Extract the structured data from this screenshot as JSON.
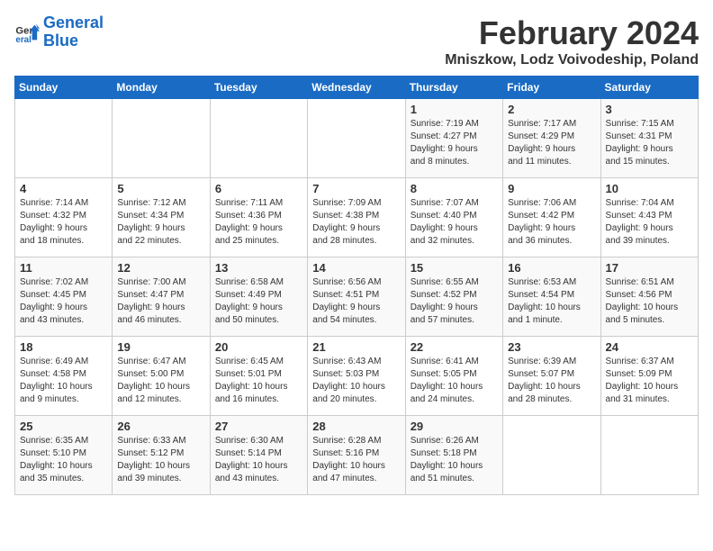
{
  "logo": {
    "line1": "General",
    "line2": "Blue"
  },
  "title": "February 2024",
  "location": "Mniszkow, Lodz Voivodeship, Poland",
  "weekdays": [
    "Sunday",
    "Monday",
    "Tuesday",
    "Wednesday",
    "Thursday",
    "Friday",
    "Saturday"
  ],
  "weeks": [
    [
      {
        "day": "",
        "info": ""
      },
      {
        "day": "",
        "info": ""
      },
      {
        "day": "",
        "info": ""
      },
      {
        "day": "",
        "info": ""
      },
      {
        "day": "1",
        "info": "Sunrise: 7:19 AM\nSunset: 4:27 PM\nDaylight: 9 hours\nand 8 minutes."
      },
      {
        "day": "2",
        "info": "Sunrise: 7:17 AM\nSunset: 4:29 PM\nDaylight: 9 hours\nand 11 minutes."
      },
      {
        "day": "3",
        "info": "Sunrise: 7:15 AM\nSunset: 4:31 PM\nDaylight: 9 hours\nand 15 minutes."
      }
    ],
    [
      {
        "day": "4",
        "info": "Sunrise: 7:14 AM\nSunset: 4:32 PM\nDaylight: 9 hours\nand 18 minutes."
      },
      {
        "day": "5",
        "info": "Sunrise: 7:12 AM\nSunset: 4:34 PM\nDaylight: 9 hours\nand 22 minutes."
      },
      {
        "day": "6",
        "info": "Sunrise: 7:11 AM\nSunset: 4:36 PM\nDaylight: 9 hours\nand 25 minutes."
      },
      {
        "day": "7",
        "info": "Sunrise: 7:09 AM\nSunset: 4:38 PM\nDaylight: 9 hours\nand 28 minutes."
      },
      {
        "day": "8",
        "info": "Sunrise: 7:07 AM\nSunset: 4:40 PM\nDaylight: 9 hours\nand 32 minutes."
      },
      {
        "day": "9",
        "info": "Sunrise: 7:06 AM\nSunset: 4:42 PM\nDaylight: 9 hours\nand 36 minutes."
      },
      {
        "day": "10",
        "info": "Sunrise: 7:04 AM\nSunset: 4:43 PM\nDaylight: 9 hours\nand 39 minutes."
      }
    ],
    [
      {
        "day": "11",
        "info": "Sunrise: 7:02 AM\nSunset: 4:45 PM\nDaylight: 9 hours\nand 43 minutes."
      },
      {
        "day": "12",
        "info": "Sunrise: 7:00 AM\nSunset: 4:47 PM\nDaylight: 9 hours\nand 46 minutes."
      },
      {
        "day": "13",
        "info": "Sunrise: 6:58 AM\nSunset: 4:49 PM\nDaylight: 9 hours\nand 50 minutes."
      },
      {
        "day": "14",
        "info": "Sunrise: 6:56 AM\nSunset: 4:51 PM\nDaylight: 9 hours\nand 54 minutes."
      },
      {
        "day": "15",
        "info": "Sunrise: 6:55 AM\nSunset: 4:52 PM\nDaylight: 9 hours\nand 57 minutes."
      },
      {
        "day": "16",
        "info": "Sunrise: 6:53 AM\nSunset: 4:54 PM\nDaylight: 10 hours\nand 1 minute."
      },
      {
        "day": "17",
        "info": "Sunrise: 6:51 AM\nSunset: 4:56 PM\nDaylight: 10 hours\nand 5 minutes."
      }
    ],
    [
      {
        "day": "18",
        "info": "Sunrise: 6:49 AM\nSunset: 4:58 PM\nDaylight: 10 hours\nand 9 minutes."
      },
      {
        "day": "19",
        "info": "Sunrise: 6:47 AM\nSunset: 5:00 PM\nDaylight: 10 hours\nand 12 minutes."
      },
      {
        "day": "20",
        "info": "Sunrise: 6:45 AM\nSunset: 5:01 PM\nDaylight: 10 hours\nand 16 minutes."
      },
      {
        "day": "21",
        "info": "Sunrise: 6:43 AM\nSunset: 5:03 PM\nDaylight: 10 hours\nand 20 minutes."
      },
      {
        "day": "22",
        "info": "Sunrise: 6:41 AM\nSunset: 5:05 PM\nDaylight: 10 hours\nand 24 minutes."
      },
      {
        "day": "23",
        "info": "Sunrise: 6:39 AM\nSunset: 5:07 PM\nDaylight: 10 hours\nand 28 minutes."
      },
      {
        "day": "24",
        "info": "Sunrise: 6:37 AM\nSunset: 5:09 PM\nDaylight: 10 hours\nand 31 minutes."
      }
    ],
    [
      {
        "day": "25",
        "info": "Sunrise: 6:35 AM\nSunset: 5:10 PM\nDaylight: 10 hours\nand 35 minutes."
      },
      {
        "day": "26",
        "info": "Sunrise: 6:33 AM\nSunset: 5:12 PM\nDaylight: 10 hours\nand 39 minutes."
      },
      {
        "day": "27",
        "info": "Sunrise: 6:30 AM\nSunset: 5:14 PM\nDaylight: 10 hours\nand 43 minutes."
      },
      {
        "day": "28",
        "info": "Sunrise: 6:28 AM\nSunset: 5:16 PM\nDaylight: 10 hours\nand 47 minutes."
      },
      {
        "day": "29",
        "info": "Sunrise: 6:26 AM\nSunset: 5:18 PM\nDaylight: 10 hours\nand 51 minutes."
      },
      {
        "day": "",
        "info": ""
      },
      {
        "day": "",
        "info": ""
      }
    ]
  ]
}
